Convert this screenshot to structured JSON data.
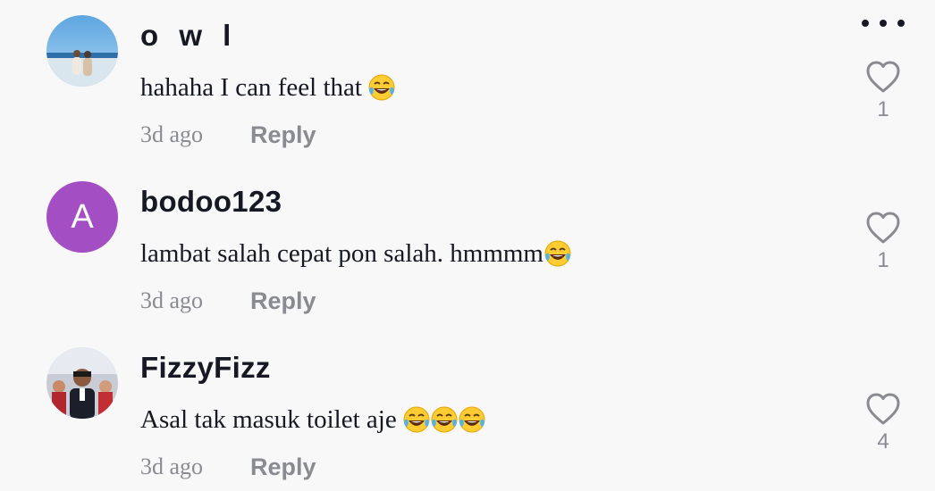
{
  "comments": [
    {
      "username": "o w l",
      "text": "hahaha I can feel that",
      "emojis": [
        "face-with-tears-of-joy"
      ],
      "timestamp": "3d ago",
      "reply_label": "Reply",
      "likes": "1",
      "avatar_type": "photo-beach-couple"
    },
    {
      "username": "bodoo123",
      "text": "lambat salah cepat pon salah. hmmmm",
      "emojis": [
        "face-with-tears-of-joy"
      ],
      "timestamp": "3d ago",
      "reply_label": "Reply",
      "likes": "1",
      "avatar_type": "letter",
      "avatar_letter": "A",
      "avatar_color": "#a34ec2"
    },
    {
      "username": "FizzyFizz",
      "text": "Asal tak masuk toilet aje",
      "emojis": [
        "face-with-tears-of-joy",
        "face-with-tears-of-joy",
        "face-with-tears-of-joy"
      ],
      "timestamp": "3d ago",
      "reply_label": "Reply",
      "likes": "4",
      "avatar_type": "photo-group"
    }
  ],
  "colors": {
    "background": "#f8f8f8",
    "primary_text": "#161823",
    "secondary_text": "#8a8b91"
  }
}
